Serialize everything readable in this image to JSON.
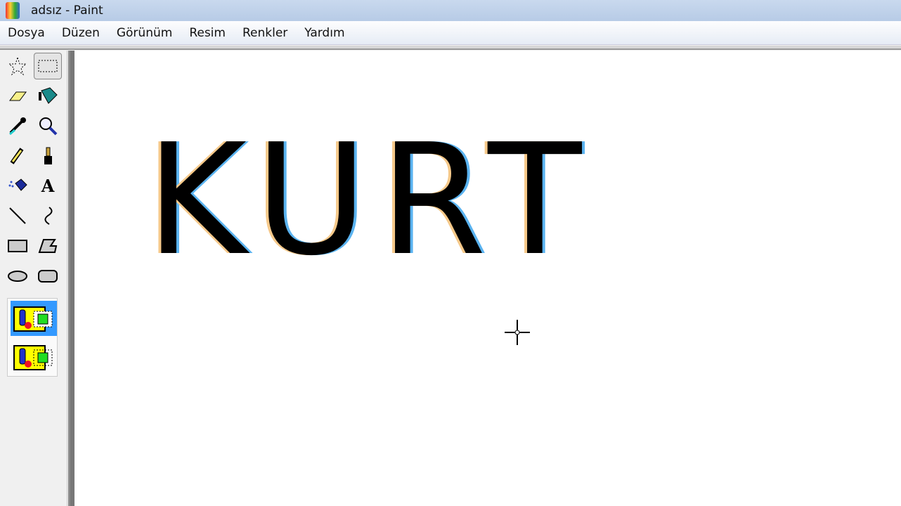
{
  "window": {
    "title": "adsız - Paint"
  },
  "menu": [
    "Dosya",
    "Düzen",
    "Görünüm",
    "Resim",
    "Renkler",
    "Yardım"
  ],
  "canvas": {
    "text": "KURT"
  },
  "tools": [
    "free-form-select",
    "select",
    "eraser",
    "fill",
    "color-picker",
    "magnifier",
    "pencil",
    "brush",
    "airbrush",
    "text",
    "line",
    "curve",
    "rectangle",
    "polygon",
    "ellipse",
    "rounded-rectangle"
  ],
  "selection_option": {
    "selected": "opaque"
  }
}
